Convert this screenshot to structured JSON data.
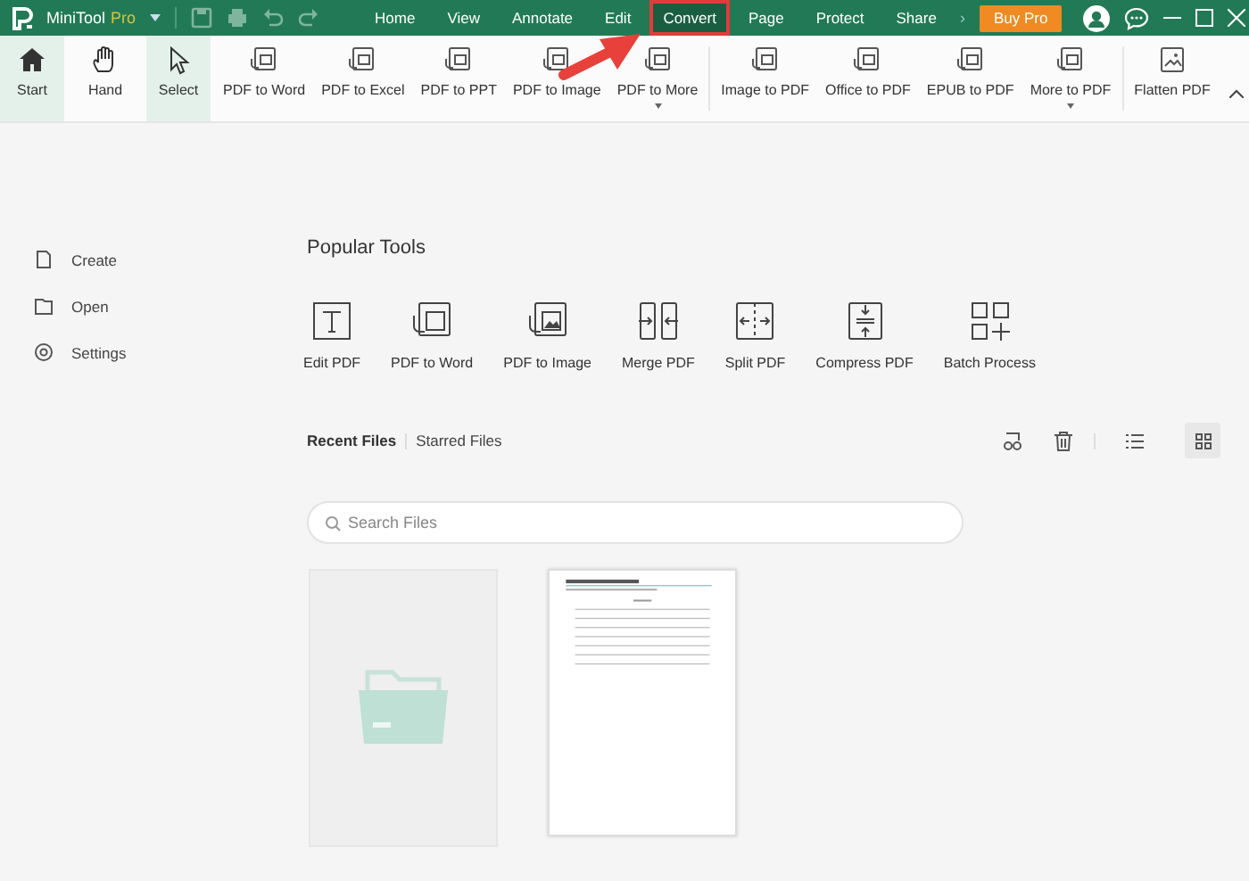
{
  "app": {
    "name": "MiniTool",
    "edition": "Pro"
  },
  "menu_tabs": [
    {
      "label": "Home",
      "selected": false,
      "highlighted": false
    },
    {
      "label": "View",
      "selected": false,
      "highlighted": false
    },
    {
      "label": "Annotate",
      "selected": false,
      "highlighted": false
    },
    {
      "label": "Edit",
      "selected": false,
      "highlighted": false
    },
    {
      "label": "Convert",
      "selected": true,
      "highlighted": true
    },
    {
      "label": "Page",
      "selected": false,
      "highlighted": false
    },
    {
      "label": "Protect",
      "selected": false,
      "highlighted": false
    },
    {
      "label": "Share",
      "selected": false,
      "highlighted": false
    }
  ],
  "more_tabs_glyph": "›",
  "buy_button": "Buy Pro",
  "ribbon_groups": [
    [
      {
        "label": "Start",
        "selected": true,
        "dropdown": false
      },
      {
        "label": "Hand",
        "selected": false,
        "dropdown": false
      },
      {
        "label": "Select",
        "selected": true,
        "dropdown": false
      }
    ],
    [
      {
        "label": "PDF to Word",
        "selected": false,
        "dropdown": false
      },
      {
        "label": "PDF to Excel",
        "selected": false,
        "dropdown": false
      },
      {
        "label": "PDF to PPT",
        "selected": false,
        "dropdown": false
      },
      {
        "label": "PDF to Image",
        "selected": false,
        "dropdown": false
      },
      {
        "label": "PDF to More",
        "selected": false,
        "dropdown": true
      }
    ],
    [
      {
        "label": "Image to PDF",
        "selected": false,
        "dropdown": false
      },
      {
        "label": "Office to PDF",
        "selected": false,
        "dropdown": false
      },
      {
        "label": "EPUB to PDF",
        "selected": false,
        "dropdown": false
      },
      {
        "label": "More to PDF",
        "selected": false,
        "dropdown": true
      }
    ],
    [
      {
        "label": "Flatten PDF",
        "selected": false,
        "dropdown": false
      }
    ]
  ],
  "sidebar": {
    "items": [
      "Create",
      "Open",
      "Settings"
    ]
  },
  "popular_tools": {
    "title": "Popular Tools",
    "items": [
      "Edit PDF",
      "PDF to Word",
      "PDF to Image",
      "Merge PDF",
      "Split PDF",
      "Compress PDF",
      "Batch Process"
    ]
  },
  "file_tabs": [
    {
      "label": "Recent Files",
      "selected": true
    },
    {
      "label": "Starred Files",
      "selected": false
    }
  ],
  "view_modes": [
    {
      "selected": false
    },
    {
      "selected": true
    }
  ],
  "search": {
    "placeholder": "Search Files"
  },
  "files": [
    {
      "kind": "open-folder"
    },
    {
      "kind": "document"
    }
  ]
}
